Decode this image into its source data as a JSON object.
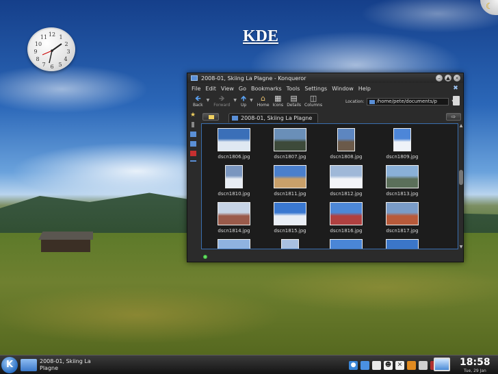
{
  "desktop": {
    "heading": "KDE",
    "clock_numbers": [
      "12",
      "1",
      "2",
      "3",
      "4",
      "5",
      "6",
      "7",
      "8",
      "9",
      "10",
      "11"
    ]
  },
  "window": {
    "title": "2008-01, Skiing La Plagne - Konqueror",
    "menu": [
      "File",
      "Edit",
      "View",
      "Go",
      "Bookmarks",
      "Tools",
      "Settings",
      "Window",
      "Help"
    ],
    "toolbar": [
      {
        "label": "Back",
        "icon": "back-arrow-icon",
        "enabled": true
      },
      {
        "label": "Forward",
        "icon": "forward-arrow-icon",
        "enabled": false
      },
      {
        "label": "Up",
        "icon": "up-arrow-icon",
        "enabled": true
      },
      {
        "label": "Home",
        "icon": "home-icon",
        "enabled": true
      },
      {
        "label": "Icons",
        "icon": "icons-view-icon",
        "enabled": true
      },
      {
        "label": "Details",
        "icon": "details-view-icon",
        "enabled": true
      },
      {
        "label": "Columns",
        "icon": "columns-view-icon",
        "enabled": true
      }
    ],
    "location_label": "Location:",
    "location_value": "/home/pete/documents/p",
    "tab_label": "2008-01, Skiing La Plagne",
    "files": [
      {
        "name": "dscn1806.jpg",
        "orientation": "landscape",
        "sky": "#3a6fb8",
        "ground": "#dfe8f2"
      },
      {
        "name": "dscn1807.jpg",
        "orientation": "landscape",
        "sky": "#6a8fb8",
        "ground": "#3d4a3a"
      },
      {
        "name": "dscn1808.jpg",
        "orientation": "portrait",
        "sky": "#5d86c0",
        "ground": "#6b5a4a"
      },
      {
        "name": "dscn1809.jpg",
        "orientation": "portrait",
        "sky": "#4d86d8",
        "ground": "#eef2f8"
      },
      {
        "name": "dscn1810.jpg",
        "orientation": "portrait",
        "sky": "#7a96bf",
        "ground": "#e8edf4"
      },
      {
        "name": "dscn1811.jpg",
        "orientation": "landscape",
        "sky": "#4a7fcc",
        "ground": "#c9a06a"
      },
      {
        "name": "dscn1812.jpg",
        "orientation": "landscape",
        "sky": "#9fb8d8",
        "ground": "#f2f4f8"
      },
      {
        "name": "dscn1813.jpg",
        "orientation": "landscape",
        "sky": "#8ab0d8",
        "ground": "#5b6f5a"
      },
      {
        "name": "dscn1814.jpg",
        "orientation": "landscape",
        "sky": "#c7d4e6",
        "ground": "#9a5a4a"
      },
      {
        "name": "dscn1815.jpg",
        "orientation": "landscape",
        "sky": "#3a78d0",
        "ground": "#e9eef5"
      },
      {
        "name": "dscn1816.jpg",
        "orientation": "landscape",
        "sky": "#4d88d8",
        "ground": "#b04040"
      },
      {
        "name": "dscn1817.jpg",
        "orientation": "landscape",
        "sky": "#7a9cc8",
        "ground": "#b85a3a"
      },
      {
        "name": "",
        "orientation": "landscape",
        "sky": "#8fb3e0",
        "ground": "#f0f3f8"
      },
      {
        "name": "",
        "orientation": "portrait",
        "sky": "#a8c0e0",
        "ground": "#e8eef6"
      },
      {
        "name": "",
        "orientation": "landscape",
        "sky": "#4a86d6",
        "ground": "#ffffff"
      },
      {
        "name": "",
        "orientation": "landscape",
        "sky": "#3b76c8",
        "ground": "#dfe6ef"
      }
    ]
  },
  "panel": {
    "task_label": "2008-01, Skiing La Plagne",
    "time": "18:58",
    "date": "Tue, 29 Jan",
    "kmenu_label": "K"
  },
  "colors": {
    "accent": "#3a6fb0",
    "window_bg": "#2b2b2b"
  }
}
